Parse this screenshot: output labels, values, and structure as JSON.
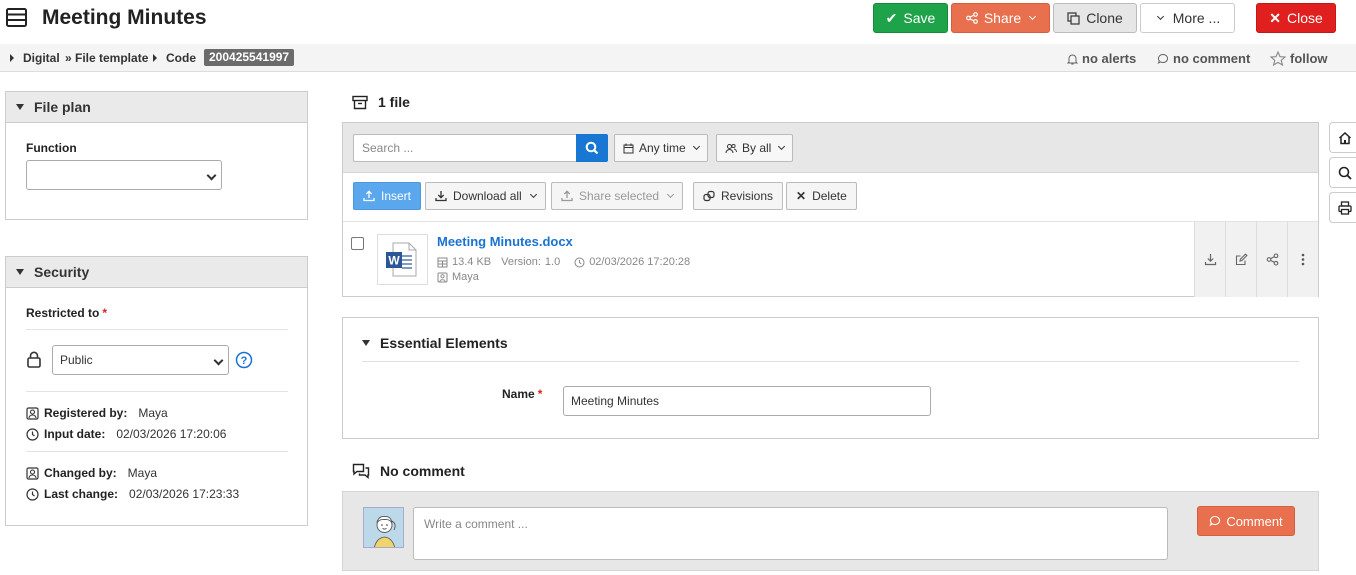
{
  "header": {
    "title": "Meeting Minutes",
    "buttons": {
      "save": "Save",
      "share": "Share",
      "clone": "Clone",
      "more": "More ...",
      "close": "Close"
    }
  },
  "breadcrumb": {
    "items": [
      "Digital",
      "» File template",
      "Code"
    ],
    "code_value": "200425541997"
  },
  "meta": {
    "alerts": "no alerts",
    "comments": "no comment",
    "follow": "follow"
  },
  "file_plan": {
    "title": "File plan",
    "function_label": "Function",
    "function_value": ""
  },
  "security": {
    "title": "Security",
    "restricted_label": "Restricted to",
    "restricted_value": "Public",
    "registered_by_label": "Registered by:",
    "registered_by_value": "Maya",
    "input_date_label": "Input date:",
    "input_date_value": "02/03/2026 17:20:06",
    "changed_by_label": "Changed by:",
    "changed_by_value": "Maya",
    "last_change_label": "Last change:",
    "last_change_value": "02/03/2026 17:23:33"
  },
  "files": {
    "count_label": "1 file",
    "search_placeholder": "Search ...",
    "filter_time": "Any time",
    "filter_user": "By all",
    "toolbar": {
      "insert": "Insert",
      "download_all": "Download all",
      "share_selected": "Share selected",
      "revisions": "Revisions",
      "delete": "Delete"
    },
    "items": [
      {
        "name": "Meeting Minutes.docx",
        "size": "13.4 KB",
        "version_label": "Version:",
        "version": "1.0",
        "date": "02/03/2026 17:20:28",
        "owner": "Maya"
      }
    ]
  },
  "essential": {
    "title": "Essential Elements",
    "name_label": "Name",
    "name_value": "Meeting Minutes"
  },
  "comments": {
    "title": "No comment",
    "placeholder": "Write a comment ...",
    "button": "Comment"
  },
  "colors": {
    "save": "#1fa34a",
    "share": "#e8704e",
    "close": "#e0201f",
    "link": "#1a73d1",
    "search_button": "#1877d2",
    "insert": "#5aa7ee"
  }
}
